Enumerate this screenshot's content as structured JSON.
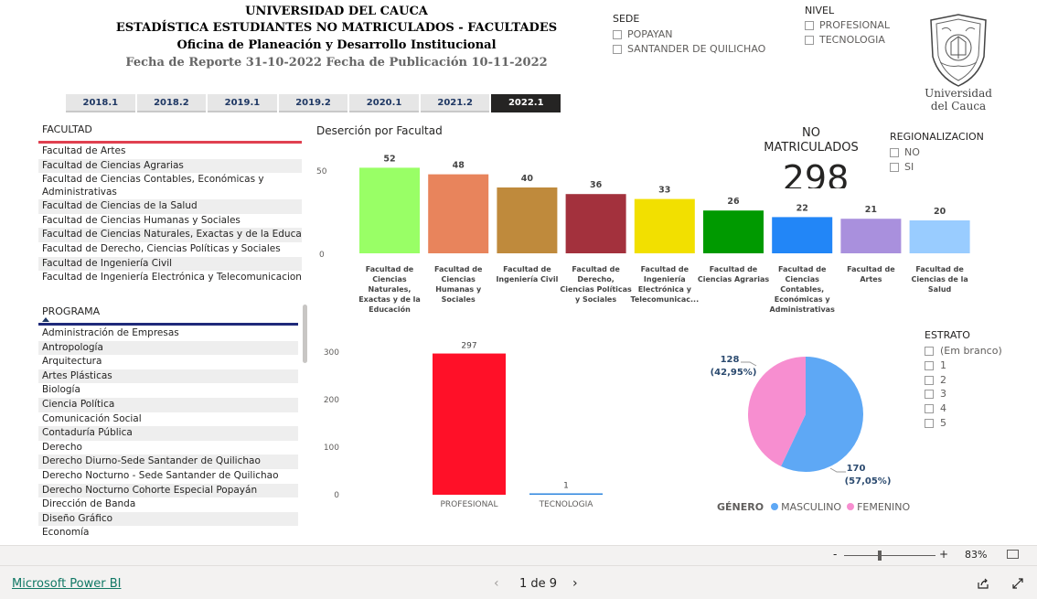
{
  "header": {
    "line1": "UNIVERSIDAD DEL CAUCA",
    "line2": "ESTADÍSTICA ESTUDIANTES NO MATRICULADOS - FACULTADES",
    "line3": "Oficina de Planeación y Desarrollo Institucional",
    "line4": "Fecha de Reporte 31-10-2022 Fecha de Publicación 10-11-2022"
  },
  "logo": {
    "line1": "Universidad",
    "line2": "del Cauca"
  },
  "sede": {
    "title": "SEDE",
    "options": [
      "POPAYAN",
      "SANTANDER DE QUILICHAO"
    ]
  },
  "nivel": {
    "title": "NIVEL",
    "options": [
      "PROFESIONAL",
      "TECNOLOGIA"
    ]
  },
  "periods": {
    "items": [
      "2018.1",
      "2018.2",
      "2019.1",
      "2019.2",
      "2020.1",
      "2021.2",
      "2022.1"
    ],
    "active": "2022.1"
  },
  "facultad": {
    "title": "FACULTAD",
    "items": [
      "Facultad de Artes",
      "Facultad de Ciencias Agrarias",
      "Facultad de Ciencias Contables, Económicas y Administrativas",
      "Facultad de Ciencias de la Salud",
      "Facultad de Ciencias Humanas y Sociales",
      "Facultad de Ciencias Naturales, Exactas y de la Educación",
      "Facultad de Derecho, Ciencias Políticas y Sociales",
      "Facultad de Ingeniería Civil",
      "Facultad de Ingeniería Electrónica y Telecomunicaciones"
    ]
  },
  "programa": {
    "title": "PROGRAMA",
    "items": [
      "Administración de Empresas",
      "Antropología",
      "Arquitectura",
      "Artes Plásticas",
      "Biología",
      "Ciencia Política",
      "Comunicación Social",
      "Contaduría Pública",
      "Derecho",
      "Derecho Diurno-Sede Santander de Quilichao",
      "Derecho Nocturno - Sede Santander de Quilichao",
      "Derecho Nocturno Cohorte Especial Popayán",
      "Dirección de Banda",
      "Diseño Gráfico",
      "Economía"
    ]
  },
  "kpi": {
    "label_line1": "NO",
    "label_line2": "MATRICULADOS",
    "value": "298"
  },
  "regionalizacion": {
    "title": "REGIONALIZACION",
    "options": [
      "NO",
      "SI"
    ]
  },
  "estrato": {
    "title": "ESTRATO",
    "options": [
      "(Em branco)",
      "1",
      "2",
      "3",
      "4",
      "5"
    ]
  },
  "chart_data": [
    {
      "type": "bar",
      "title": "Deserción por Facultad",
      "categories": [
        [
          "Facultad de",
          "Ciencias",
          "Naturales,",
          "Exactas y de la",
          "Educación"
        ],
        [
          "Facultad de",
          "Ciencias",
          "Humanas y",
          "Sociales"
        ],
        [
          "Facultad de",
          "Ingeniería Civil"
        ],
        [
          "Facultad de",
          "Derecho,",
          "Ciencias Políticas",
          "y Sociales"
        ],
        [
          "Facultad de",
          "Ingeniería",
          "Electrónica y",
          "Telecomunicac..."
        ],
        [
          "Facultad de",
          "Ciencias Agrarias"
        ],
        [
          "Facultad de",
          "Ciencias",
          "Contables,",
          "Económicas y",
          "Administrativas"
        ],
        [
          "Facultad de",
          "Artes"
        ],
        [
          "Facultad de",
          "Ciencias de la",
          "Salud"
        ]
      ],
      "values": [
        52,
        48,
        40,
        36,
        33,
        26,
        22,
        21,
        20
      ],
      "colors": [
        "#99ff66",
        "#e8845c",
        "#bf8a3c",
        "#a3313d",
        "#f2e000",
        "#009a00",
        "#2286f7",
        "#a990dd",
        "#99ccff"
      ],
      "yticks": [
        "50",
        "0"
      ],
      "ylim": [
        0,
        55
      ]
    },
    {
      "type": "bar",
      "categories": [
        "PROFESIONAL",
        "TECNOLOGIA"
      ],
      "values": [
        297,
        1
      ],
      "colors": [
        "#ff1028",
        "#2e86de"
      ],
      "yticks": [
        "300",
        "200",
        "100",
        "0"
      ],
      "ylim": [
        0,
        300
      ]
    },
    {
      "type": "pie",
      "legend_title": "GÉNERO",
      "series": [
        {
          "name": "MASCULINO",
          "value": 170,
          "label": "170",
          "pct": "(57,05%)",
          "color": "#5ea8f5"
        },
        {
          "name": "FEMENINO",
          "value": 128,
          "label": "128",
          "pct": "(42,95%)",
          "color": "#f78ed0"
        }
      ]
    }
  ],
  "zoom": {
    "minus": "-",
    "plus": "+",
    "level": "83%"
  },
  "footer": {
    "brand": "Microsoft Power BI",
    "page": "1 de 9"
  }
}
